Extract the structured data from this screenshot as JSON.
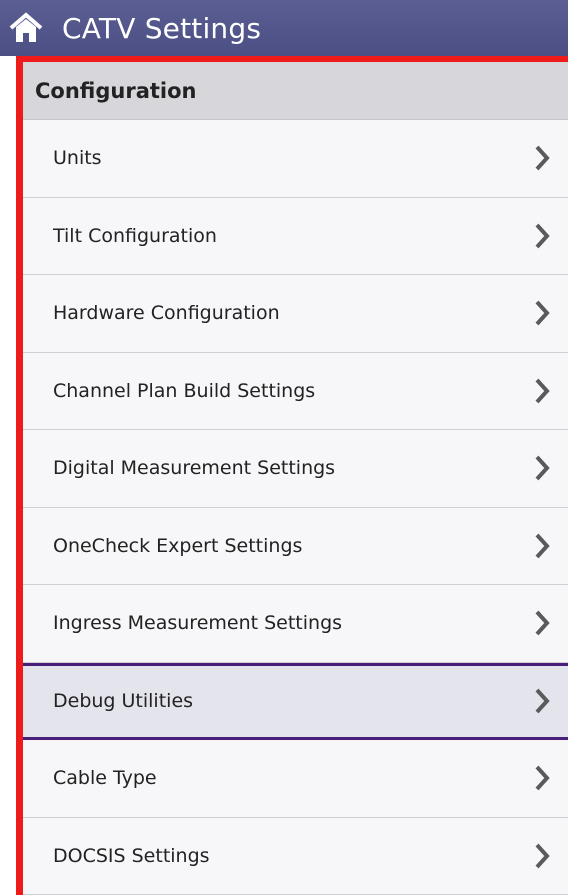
{
  "header": {
    "title": "CATV Settings",
    "home_icon": "home-icon",
    "background": "#50548a"
  },
  "section": {
    "title": "Configuration"
  },
  "items": [
    {
      "label": "Units"
    },
    {
      "label": "Tilt Configuration"
    },
    {
      "label": "Hardware Configuration"
    },
    {
      "label": "Channel Plan Build Settings"
    },
    {
      "label": "Digital Measurement Settings"
    },
    {
      "label": "OneCheck Expert Settings"
    },
    {
      "label": "Ingress Measurement Settings"
    },
    {
      "label": "Debug Utilities",
      "selected": true
    },
    {
      "label": "Cable Type"
    },
    {
      "label": "DOCSIS Settings"
    }
  ],
  "colors": {
    "highlight_border": "#ef1b1b",
    "selected_border": "#4a1f7a",
    "chevron": "#5a5a5a"
  }
}
